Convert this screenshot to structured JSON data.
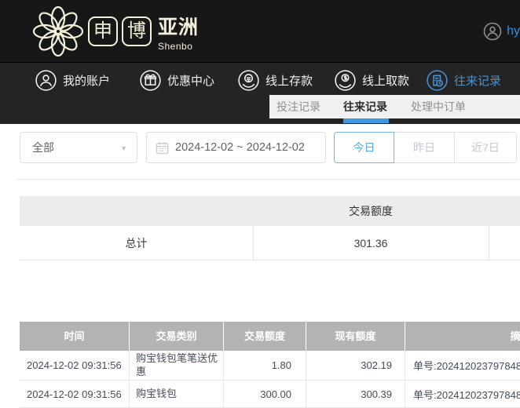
{
  "header": {
    "logo": {
      "box1": "申",
      "box2": "博",
      "region": "亚洲",
      "subtitle": "Shenbo"
    },
    "user": {
      "name": "hy"
    }
  },
  "nav": {
    "items": [
      {
        "label": "我的账户"
      },
      {
        "label": "优惠中心"
      },
      {
        "label": "线上存款"
      },
      {
        "label": "线上取款"
      },
      {
        "label": "往来记录"
      }
    ],
    "active_index": 4
  },
  "tabs": [
    {
      "label": "投注记录"
    },
    {
      "label": "往来记录"
    },
    {
      "label": "处理中订单"
    }
  ],
  "filters": {
    "type_dropdown": {
      "value": "全部"
    },
    "date_range": "2024-12-02 ~ 2024-12-02",
    "quick_buttons": [
      {
        "label": "今日"
      },
      {
        "label": "昨日"
      },
      {
        "label": "近7日"
      }
    ]
  },
  "summary_table": {
    "amount_header": "交易额度",
    "total_label": "总计",
    "total_amount": "301.36"
  },
  "records_table": {
    "columns": [
      "时间",
      "交易类别",
      "交易额度",
      "现有额度",
      "摘要"
    ],
    "rows": [
      {
        "time": "2024-12-02 09:31:56",
        "type": "购宝钱包笔笔送优惠",
        "amount": "1.80",
        "balance": "302.19",
        "note": "单号:202412023797848"
      },
      {
        "time": "2024-12-02 09:31:56",
        "type": "购宝钱包",
        "amount": "300.00",
        "balance": "300.39",
        "note": "单号:202412023797848"
      }
    ]
  },
  "colors": {
    "accent_blue": "#3c9ae0",
    "nav_active_blue": "#4a90cf",
    "button_blue": "#57ade2",
    "header_bg": "#171717",
    "nav_bg": "#242424",
    "table_header_gray": "#b3b3b3",
    "logo_cream": "#f5f0da"
  }
}
